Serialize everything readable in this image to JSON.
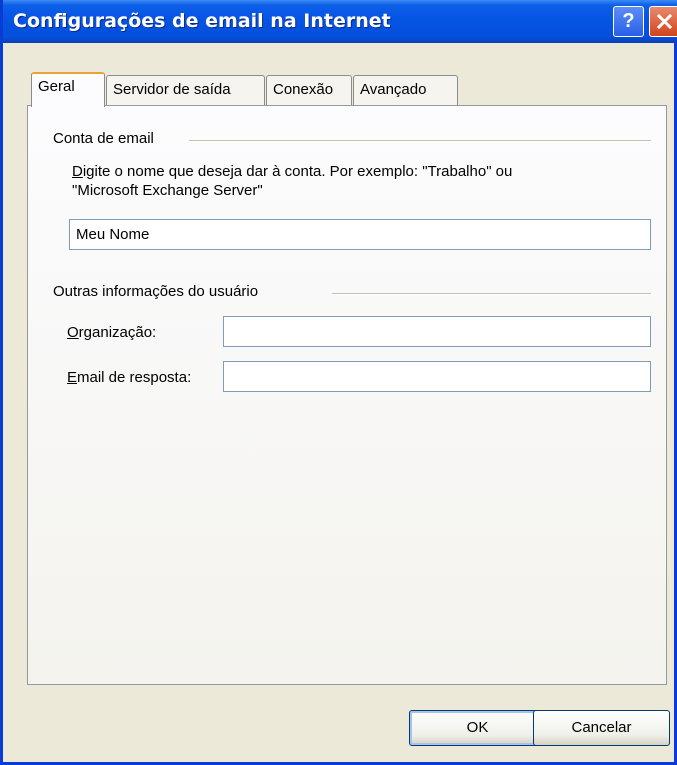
{
  "window": {
    "title": "Configurações de email na Internet",
    "help_label": "?"
  },
  "tabs": [
    {
      "label": "Geral",
      "active": true
    },
    {
      "label": "Servidor de saída",
      "active": false
    },
    {
      "label": "Conexão",
      "active": false
    },
    {
      "label": "Avançado",
      "active": false
    }
  ],
  "account_group": {
    "title": "Conta de email",
    "hint_line1_first": "D",
    "hint_line1_rest": "igite o nome que deseja dar à conta. Por exemplo: \"Trabalho\" ou",
    "hint_line2": "\"Microsoft Exchange Server\"",
    "account_name_value": "Meu Nome"
  },
  "user_info_group": {
    "title": "Outras informações do usuário",
    "organization_label_first": "O",
    "organization_label_rest": "rganização:",
    "organization_value": "",
    "reply_email_label_first": "E",
    "reply_email_label_rest": "mail de resposta:",
    "reply_email_value": ""
  },
  "buttons": {
    "ok": "OK",
    "cancel": "Cancelar"
  },
  "colors": {
    "titlebar": "#0554e3",
    "dialog_bg": "#ece9d8",
    "active_tab_accent": "#e8a33a"
  }
}
